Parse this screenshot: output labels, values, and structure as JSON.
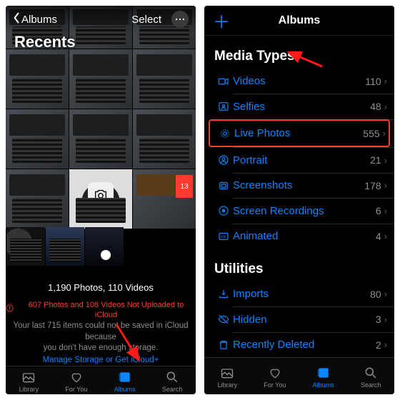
{
  "left": {
    "back_label": "Albums",
    "select_label": "Select",
    "album_title": "Recents",
    "camera_icon_label": "Camera",
    "count_line": "1,190 Photos, 110 Videos",
    "warn_line": "607 Photos and 108 Videos Not Uploaded to iCloud",
    "warn_sub1": "Your last 715 items could not be saved in iCloud because",
    "warn_sub2": "you don't have enough storage.",
    "manage_link": "Manage Storage or Get iCloud+",
    "tabs": [
      {
        "label": "Library"
      },
      {
        "label": "For You"
      },
      {
        "label": "Albums"
      },
      {
        "label": "Search"
      }
    ]
  },
  "right": {
    "title": "Albums",
    "section1": "Media Types",
    "section2": "Utilities",
    "rows": [
      {
        "label": "Videos",
        "count": "110"
      },
      {
        "label": "Selfies",
        "count": "48"
      },
      {
        "label": "Live Photos",
        "count": "555"
      },
      {
        "label": "Portrait",
        "count": "21"
      },
      {
        "label": "Screenshots",
        "count": "178"
      },
      {
        "label": "Screen Recordings",
        "count": "6"
      },
      {
        "label": "Animated",
        "count": "4"
      }
    ],
    "util_rows": [
      {
        "label": "Imports",
        "count": "80"
      },
      {
        "label": "Hidden",
        "count": "3"
      },
      {
        "label": "Recently Deleted",
        "count": "2"
      }
    ],
    "tabs": [
      {
        "label": "Library"
      },
      {
        "label": "For You"
      },
      {
        "label": "Albums"
      },
      {
        "label": "Search"
      }
    ]
  }
}
